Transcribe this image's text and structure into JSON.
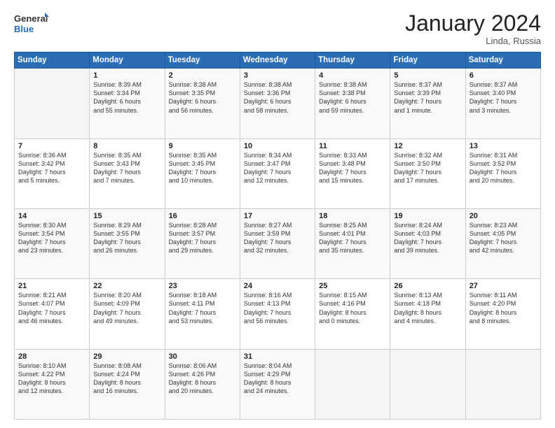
{
  "logo": {
    "general": "General",
    "blue": "Blue"
  },
  "header": {
    "month": "January 2024",
    "location": "Linda, Russia"
  },
  "weekdays": [
    "Sunday",
    "Monday",
    "Tuesday",
    "Wednesday",
    "Thursday",
    "Friday",
    "Saturday"
  ],
  "weeks": [
    [
      {
        "day": "",
        "info": ""
      },
      {
        "day": "1",
        "info": "Sunrise: 8:39 AM\nSunset: 3:34 PM\nDaylight: 6 hours\nand 55 minutes."
      },
      {
        "day": "2",
        "info": "Sunrise: 8:38 AM\nSunset: 3:35 PM\nDaylight: 6 hours\nand 56 minutes."
      },
      {
        "day": "3",
        "info": "Sunrise: 8:38 AM\nSunset: 3:36 PM\nDaylight: 6 hours\nand 58 minutes."
      },
      {
        "day": "4",
        "info": "Sunrise: 8:38 AM\nSunset: 3:38 PM\nDaylight: 6 hours\nand 59 minutes."
      },
      {
        "day": "5",
        "info": "Sunrise: 8:37 AM\nSunset: 3:39 PM\nDaylight: 7 hours\nand 1 minute."
      },
      {
        "day": "6",
        "info": "Sunrise: 8:37 AM\nSunset: 3:40 PM\nDaylight: 7 hours\nand 3 minutes."
      }
    ],
    [
      {
        "day": "7",
        "info": "Sunrise: 8:36 AM\nSunset: 3:42 PM\nDaylight: 7 hours\nand 5 minutes."
      },
      {
        "day": "8",
        "info": "Sunrise: 8:35 AM\nSunset: 3:43 PM\nDaylight: 7 hours\nand 7 minutes."
      },
      {
        "day": "9",
        "info": "Sunrise: 8:35 AM\nSunset: 3:45 PM\nDaylight: 7 hours\nand 10 minutes."
      },
      {
        "day": "10",
        "info": "Sunrise: 8:34 AM\nSunset: 3:47 PM\nDaylight: 7 hours\nand 12 minutes."
      },
      {
        "day": "11",
        "info": "Sunrise: 8:33 AM\nSunset: 3:48 PM\nDaylight: 7 hours\nand 15 minutes."
      },
      {
        "day": "12",
        "info": "Sunrise: 8:32 AM\nSunset: 3:50 PM\nDaylight: 7 hours\nand 17 minutes."
      },
      {
        "day": "13",
        "info": "Sunrise: 8:31 AM\nSunset: 3:52 PM\nDaylight: 7 hours\nand 20 minutes."
      }
    ],
    [
      {
        "day": "14",
        "info": "Sunrise: 8:30 AM\nSunset: 3:54 PM\nDaylight: 7 hours\nand 23 minutes."
      },
      {
        "day": "15",
        "info": "Sunrise: 8:29 AM\nSunset: 3:55 PM\nDaylight: 7 hours\nand 26 minutes."
      },
      {
        "day": "16",
        "info": "Sunrise: 8:28 AM\nSunset: 3:57 PM\nDaylight: 7 hours\nand 29 minutes."
      },
      {
        "day": "17",
        "info": "Sunrise: 8:27 AM\nSunset: 3:59 PM\nDaylight: 7 hours\nand 32 minutes."
      },
      {
        "day": "18",
        "info": "Sunrise: 8:25 AM\nSunset: 4:01 PM\nDaylight: 7 hours\nand 35 minutes."
      },
      {
        "day": "19",
        "info": "Sunrise: 8:24 AM\nSunset: 4:03 PM\nDaylight: 7 hours\nand 39 minutes."
      },
      {
        "day": "20",
        "info": "Sunrise: 8:23 AM\nSunset: 4:05 PM\nDaylight: 7 hours\nand 42 minutes."
      }
    ],
    [
      {
        "day": "21",
        "info": "Sunrise: 8:21 AM\nSunset: 4:07 PM\nDaylight: 7 hours\nand 46 minutes."
      },
      {
        "day": "22",
        "info": "Sunrise: 8:20 AM\nSunset: 4:09 PM\nDaylight: 7 hours\nand 49 minutes."
      },
      {
        "day": "23",
        "info": "Sunrise: 8:18 AM\nSunset: 4:11 PM\nDaylight: 7 hours\nand 53 minutes."
      },
      {
        "day": "24",
        "info": "Sunrise: 8:16 AM\nSunset: 4:13 PM\nDaylight: 7 hours\nand 56 minutes."
      },
      {
        "day": "25",
        "info": "Sunrise: 8:15 AM\nSunset: 4:16 PM\nDaylight: 8 hours\nand 0 minutes."
      },
      {
        "day": "26",
        "info": "Sunrise: 8:13 AM\nSunset: 4:18 PM\nDaylight: 8 hours\nand 4 minutes."
      },
      {
        "day": "27",
        "info": "Sunrise: 8:11 AM\nSunset: 4:20 PM\nDaylight: 8 hours\nand 8 minutes."
      }
    ],
    [
      {
        "day": "28",
        "info": "Sunrise: 8:10 AM\nSunset: 4:22 PM\nDaylight: 8 hours\nand 12 minutes."
      },
      {
        "day": "29",
        "info": "Sunrise: 8:08 AM\nSunset: 4:24 PM\nDaylight: 8 hours\nand 16 minutes."
      },
      {
        "day": "30",
        "info": "Sunrise: 8:06 AM\nSunset: 4:26 PM\nDaylight: 8 hours\nand 20 minutes."
      },
      {
        "day": "31",
        "info": "Sunrise: 8:04 AM\nSunset: 4:29 PM\nDaylight: 8 hours\nand 24 minutes."
      },
      {
        "day": "",
        "info": ""
      },
      {
        "day": "",
        "info": ""
      },
      {
        "day": "",
        "info": ""
      }
    ]
  ]
}
